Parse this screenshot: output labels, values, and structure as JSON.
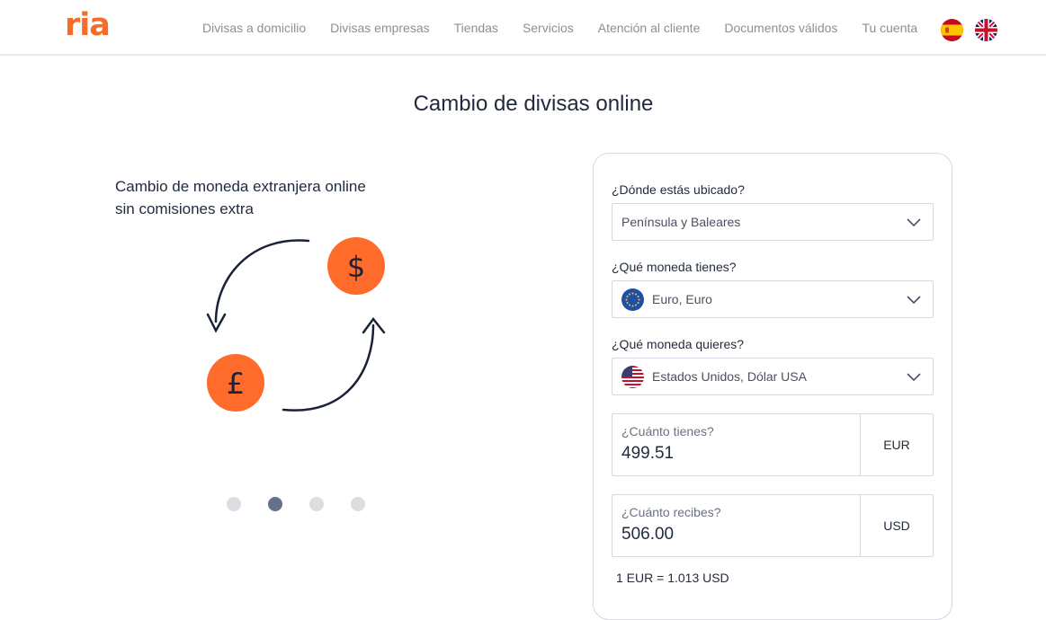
{
  "header": {
    "logo": "ria",
    "nav": [
      "Divisas a domicilio",
      "Divisas empresas",
      "Tiendas",
      "Servicios",
      "Atención al cliente",
      "Documentos válidos",
      "Tu cuenta"
    ],
    "languages": [
      "spain-flag-icon",
      "uk-flag-icon"
    ]
  },
  "page": {
    "title": "Cambio de divisas online"
  },
  "promo": {
    "text": "Cambio de moneda extranjera online sin comisiones extra",
    "icons": [
      "dollar-coin-icon",
      "pound-coin-icon",
      "exchange-arrows-icon"
    ],
    "slides_total": 4,
    "active_slide": 2
  },
  "form": {
    "location_label": "¿Dónde estás ubicado?",
    "location_value": "Península y Baleares",
    "from_label": "¿Qué moneda tienes?",
    "from_value": "Euro, Euro",
    "from_flag": "eu-flag-icon",
    "to_label": "¿Qué moneda quieres?",
    "to_value": "Estados Unidos, Dólar USA",
    "to_flag": "us-flag-icon",
    "have_label": "¿Cuánto tienes?",
    "have_amount": "499.51",
    "have_currency": "EUR",
    "receive_label": "¿Cuánto recibes?",
    "receive_amount": "506.00",
    "receive_currency": "USD",
    "rate_text": "1 EUR = 1.013 USD"
  },
  "colors": {
    "brand": "#f46e29",
    "text_dark": "#1f2a3c",
    "nav_text": "#8a8f99",
    "dot_active": "#67708a",
    "dot_inactive": "#dcdde3",
    "border": "#d6d8de"
  }
}
